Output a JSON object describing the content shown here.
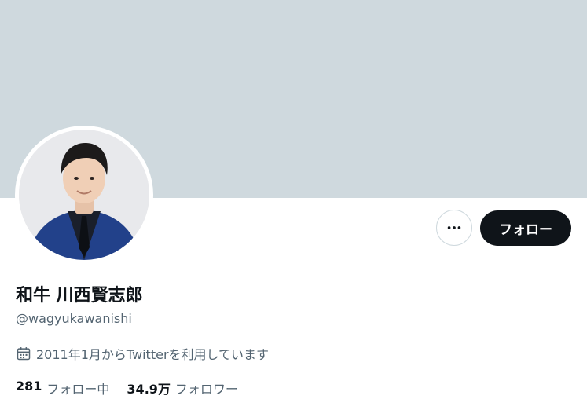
{
  "profile": {
    "display_name": "和牛 川西賢志郎",
    "handle": "@wagyukawanishi",
    "joined": "2011年1月からTwitterを利用しています",
    "follow_label": "フォロー",
    "stats": {
      "following_count": "281",
      "following_label": "フォロー中",
      "followers_count": "34.9万",
      "followers_label": "フォロワー"
    }
  },
  "icons": {
    "more": "more-dots-icon",
    "calendar": "calendar-icon"
  },
  "colors": {
    "banner": "#cfd9de",
    "follow_button_bg": "#0f1419",
    "secondary_text": "#536471"
  }
}
